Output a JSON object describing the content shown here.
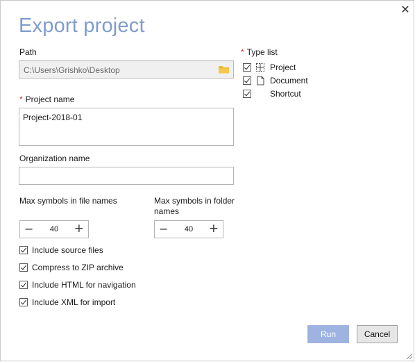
{
  "dialog": {
    "title": "Export project",
    "close_glyph": "✕"
  },
  "path": {
    "label": "Path",
    "value": "C:\\Users\\Grishko\\Desktop",
    "icon": "folder-icon"
  },
  "project_name": {
    "required_mark": "*",
    "label": "Project name",
    "value": "Project-2018-01"
  },
  "organization_name": {
    "label": "Organization name",
    "value": ""
  },
  "max_file_symbols": {
    "label": "Max symbols in file names",
    "value": "40",
    "minus": "−",
    "plus": "+"
  },
  "max_folder_symbols": {
    "label": "Max symbols in folder names",
    "value": "40",
    "minus": "−",
    "plus": "+"
  },
  "options": [
    {
      "label": "Include source files",
      "checked": true
    },
    {
      "label": "Compress to ZIP archive",
      "checked": true
    },
    {
      "label": "Include HTML for navigation",
      "checked": true
    },
    {
      "label": "Include XML for import",
      "checked": true
    }
  ],
  "type_list": {
    "required_mark": "*",
    "label": "Type list",
    "items": [
      {
        "label": "Project",
        "checked": true,
        "icon": "project-icon"
      },
      {
        "label": "Document",
        "checked": true,
        "icon": "document-icon"
      },
      {
        "label": "Shortcut",
        "checked": true,
        "icon": ""
      }
    ]
  },
  "buttons": {
    "run": "Run",
    "cancel": "Cancel"
  },
  "colors": {
    "title": "#7f9ccf",
    "run_button": "#9fb3e1",
    "required": "#dd3333",
    "folder": "#e8b931"
  }
}
